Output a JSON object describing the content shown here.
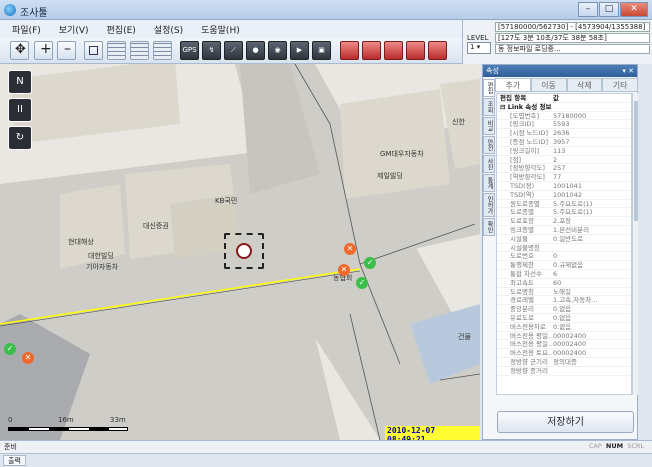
{
  "window": {
    "title": "조사툴"
  },
  "menu": [
    "파일(F)",
    "보기(V)",
    "편집(E)",
    "설정(S)",
    "도움말(H)"
  ],
  "level": {
    "label": "LEVEL",
    "value": "1",
    "lines": [
      "[57180000/562730] - [4573904/1355388]",
      "[127도 3분 10초/37도 38분 58초]",
      "동 정보파일 로딩중..."
    ]
  },
  "toolbar": {
    "gps_label": "GPS"
  },
  "map": {
    "labels": [
      "신한",
      "GM대우자동차",
      "제일빌딩",
      "KB국민",
      "대신증권",
      "현대해상",
      "대한빌딩",
      "기아자동차",
      "농협회",
      "건물"
    ],
    "timestamp": "2010-12-07 08:49:21",
    "scale": {
      "s0": "0",
      "s1": "16m",
      "s2": "33m"
    },
    "controls": {
      "north": "N",
      "pause": "II",
      "refresh": "↻"
    }
  },
  "panel": {
    "header": "속성",
    "close": "▾ ✕",
    "tabs": [
      "추가",
      "이동",
      "삭제",
      "기타"
    ],
    "vtabs": [
      "편집",
      "조회",
      "비교",
      "안전",
      "사진",
      "통계",
      "인허가",
      "확인",
      "편집"
    ],
    "col_key": "편집 항목",
    "col_val": "값",
    "group": "⊟ Link 속성 정보",
    "rows": [
      {
        "k": "[도엽번호]",
        "v": "57180000"
      },
      {
        "k": "[링크ID]",
        "v": "5593"
      },
      {
        "k": "[시점 노드ID]",
        "v": "2636"
      },
      {
        "k": "[종점 노드ID]",
        "v": "3957"
      },
      {
        "k": "[링크길이]",
        "v": "113"
      },
      {
        "k": "[점]",
        "v": "2"
      },
      {
        "k": "[정방향각도]",
        "v": "257"
      },
      {
        "k": "[역방향각도]",
        "v": "77"
      },
      {
        "k": "TSD(정)",
        "v": "1001041"
      },
      {
        "k": "TSD(역)",
        "v": "1001042"
      },
      {
        "k": "원도로종별",
        "v": "5.주요도로(1)"
      },
      {
        "k": "도로종별",
        "v": "5.주요도로(1)"
      },
      {
        "k": "도로포장",
        "v": "2.포장"
      },
      {
        "k": "링크종별",
        "v": "1.본선비분리"
      },
      {
        "k": "시설물",
        "v": "0.일반도로"
      },
      {
        "k": "시설물명칭",
        "v": ""
      },
      {
        "k": "도로번호",
        "v": "0"
      },
      {
        "k": "통행제한",
        "v": "0.규제없음"
      },
      {
        "k": "통합 차선수",
        "v": "6"
      },
      {
        "k": "최고속도",
        "v": "60"
      },
      {
        "k": "도로명칭",
        "v": "노해길"
      },
      {
        "k": "경로레벨",
        "v": "1.고속,자동차..."
      },
      {
        "k": "중앙분리",
        "v": "0.없음"
      },
      {
        "k": "유료도로",
        "v": "0.없음"
      },
      {
        "k": "버스전용차로",
        "v": "0.없음"
      },
      {
        "k": "버스전용 평일...",
        "v": "00002400"
      },
      {
        "k": "버스전용 평일...",
        "v": "00002400"
      },
      {
        "k": "버스전용 토요...",
        "v": "00002400"
      },
      {
        "k": "정방향 군기리",
        "v": "정의대증"
      },
      {
        "k": "정방향 종거리",
        "v": ""
      }
    ],
    "save": "저장하기"
  },
  "status": {
    "ready": "준비",
    "cap": "CAP",
    "num": "NUM",
    "scrl": "SCRL"
  },
  "output": {
    "tab": "출력"
  },
  "colors": {
    "accent": "#2f5e99",
    "road": "#c9c7c2",
    "building": "#d9d5c8",
    "timestamp_bg": "#ffff33"
  }
}
